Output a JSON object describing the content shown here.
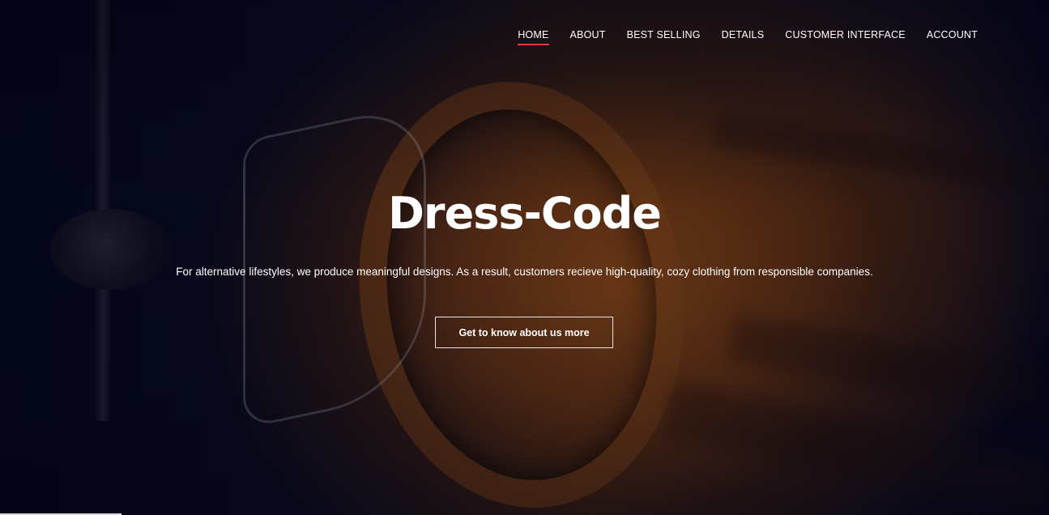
{
  "nav": {
    "items": [
      {
        "label": "HOME",
        "active": true
      },
      {
        "label": "ABOUT",
        "active": false
      },
      {
        "label": "BEST SELLING",
        "active": false
      },
      {
        "label": "DETAILS",
        "active": false
      },
      {
        "label": "CUSTOMER INTERFACE",
        "active": false
      },
      {
        "label": "ACCOUNT",
        "active": false
      }
    ],
    "active_color": "#e03a3a"
  },
  "hero": {
    "title": "Dress-Code",
    "tagline": "For alternative lifestyles, we produce meaningful designs. As a result, customers recieve high-quality, cozy clothing from responsible companies.",
    "cta_label": "Get to know about us more",
    "background_image": "dark-tshirt-on-hanger-photo"
  },
  "colors": {
    "background": "#05071a",
    "text": "#ffffff",
    "accent": "#e03a3a"
  }
}
